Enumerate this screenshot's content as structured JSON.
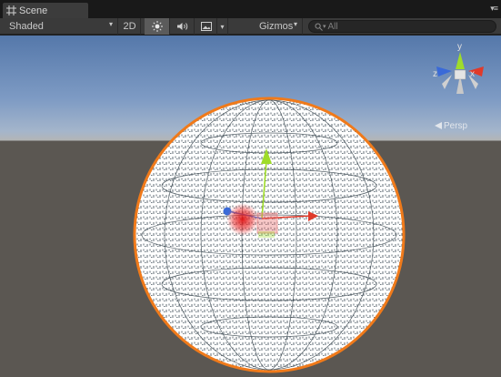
{
  "tab": {
    "title": "Scene"
  },
  "toolbar": {
    "shading_mode": "Shaded",
    "toggle_2d": "2D",
    "gizmos_label": "Gizmos",
    "search_placeholder": "All"
  },
  "orientation_gizmo": {
    "axis_y": "y",
    "axis_z": "z",
    "axis_x": "x",
    "view_label": "Persp"
  },
  "colors": {
    "selection_outline": "#f07a1a",
    "axis_x": "#e03a2a",
    "axis_y": "#9fdc2a",
    "axis_z": "#3a6ad8"
  }
}
